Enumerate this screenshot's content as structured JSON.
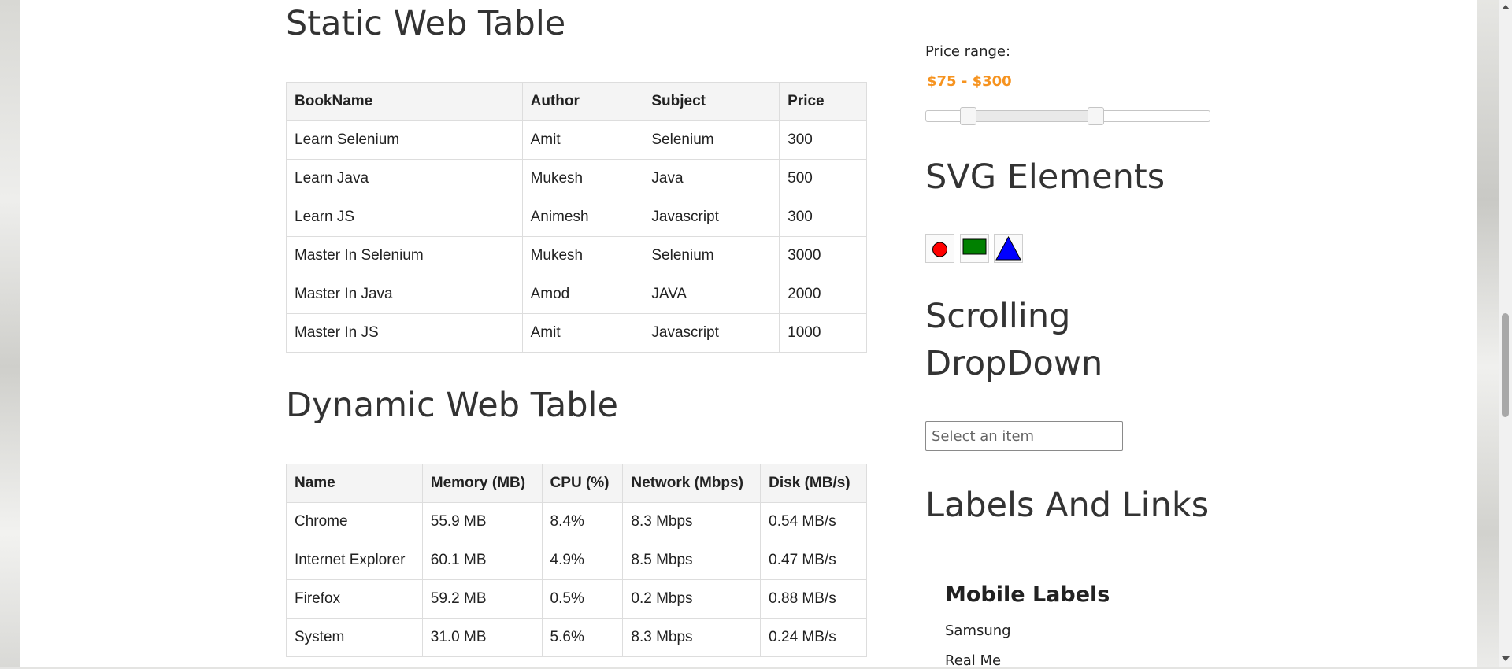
{
  "static_table": {
    "title": "Static Web Table",
    "headers": [
      "BookName",
      "Author",
      "Subject",
      "Price"
    ],
    "rows": [
      [
        "Learn Selenium",
        "Amit",
        "Selenium",
        "300"
      ],
      [
        "Learn Java",
        "Mukesh",
        "Java",
        "500"
      ],
      [
        "Learn JS",
        "Animesh",
        "Javascript",
        "300"
      ],
      [
        "Master In Selenium",
        "Mukesh",
        "Selenium",
        "3000"
      ],
      [
        "Master In Java",
        "Amod",
        "JAVA",
        "2000"
      ],
      [
        "Master In JS",
        "Amit",
        "Javascript",
        "1000"
      ]
    ]
  },
  "dynamic_table": {
    "title": "Dynamic Web Table",
    "headers": [
      "Name",
      "Memory (MB)",
      "CPU (%)",
      "Network (Mbps)",
      "Disk (MB/s)"
    ],
    "rows": [
      [
        "Chrome",
        "55.9 MB",
        "8.4%",
        "8.3 Mbps",
        "0.54 MB/s"
      ],
      [
        "Internet Explorer",
        "60.1 MB",
        "4.9%",
        "8.5 Mbps",
        "0.47 MB/s"
      ],
      [
        "Firefox",
        "59.2 MB",
        "0.5%",
        "0.2 Mbps",
        "0.88 MB/s"
      ],
      [
        "System",
        "31.0 MB",
        "5.6%",
        "8.3 Mbps",
        "0.24 MB/s"
      ]
    ]
  },
  "price_range": {
    "label": "Price range:",
    "value_text": "$75 - $300",
    "accent_color": "#f6931f",
    "slider_min_fraction": 0.15,
    "slider_max_fraction": 0.6
  },
  "svg_elements": {
    "title": "SVG Elements",
    "shapes": [
      {
        "name": "circle-icon",
        "fill": "#ff0000"
      },
      {
        "name": "rectangle-icon",
        "fill": "#008000"
      },
      {
        "name": "triangle-icon",
        "fill": "#0000ff"
      }
    ]
  },
  "scrolling_dropdown": {
    "title_line1": "Scrolling",
    "title_line2": "DropDown",
    "placeholder": "Select an item"
  },
  "labels_links": {
    "title": "Labels And Links",
    "mobile_heading": "Mobile Labels",
    "items": [
      "Samsung",
      "Real Me"
    ]
  }
}
